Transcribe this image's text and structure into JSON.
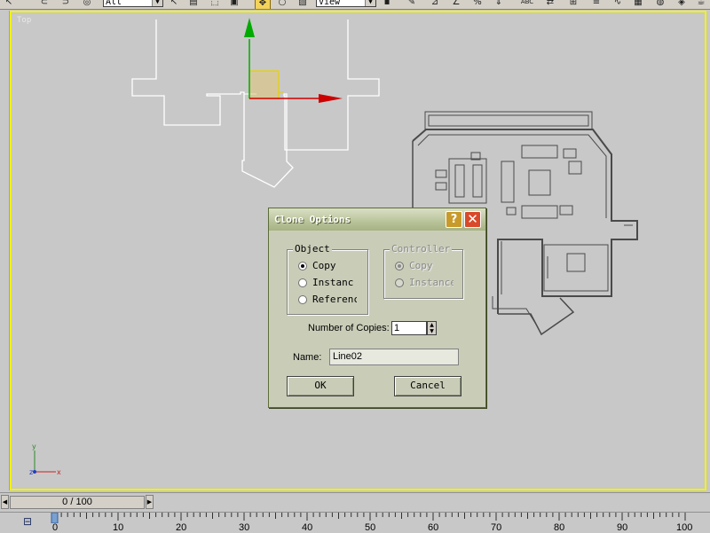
{
  "toolbar": {
    "selection_filter": "All",
    "reference_coord": "View",
    "icons": [
      "undo-icon",
      "redo-icon",
      "link-icon",
      "unlink-icon",
      "bind-icon",
      "select-icon",
      "select-by-name-icon",
      "region-select-icon",
      "filter-icon",
      "move-icon",
      "rotate-icon",
      "scale-icon",
      "pivot-icon",
      "mirror-icon",
      "align-icon",
      "named-selection-icon",
      "layer-icon",
      "curve-editor-icon",
      "render-icon"
    ]
  },
  "viewport": {
    "label": "Top",
    "border_color": "#f2f200",
    "gizmo_x_color": "#cc0000",
    "gizmo_y_color": "#00aa00",
    "gizmo_plane_color": "#e8d070"
  },
  "axis_tripod": {
    "x": "x",
    "y": "y",
    "z": "z"
  },
  "dialog": {
    "title": "Clone Options",
    "help_label": "?",
    "close_label": "✕",
    "object_group": {
      "legend": "Object",
      "options": [
        {
          "label": "Copy",
          "checked": true
        },
        {
          "label": "Instance",
          "checked": false
        },
        {
          "label": "Reference",
          "checked": false
        }
      ]
    },
    "controller_group": {
      "legend": "Controller",
      "options": [
        {
          "label": "Copy",
          "checked": true
        },
        {
          "label": "Instance",
          "checked": false
        }
      ]
    },
    "copies_label": "Number of Copies:",
    "copies_value": "1",
    "name_label": "Name:",
    "name_value": "Line02",
    "ok_label": "OK",
    "cancel_label": "Cancel"
  },
  "timeline": {
    "slider_text": "0 / 100",
    "ruler_labels": [
      "0",
      "10",
      "20",
      "30",
      "40",
      "50",
      "60",
      "70",
      "80",
      "90",
      "100"
    ]
  }
}
